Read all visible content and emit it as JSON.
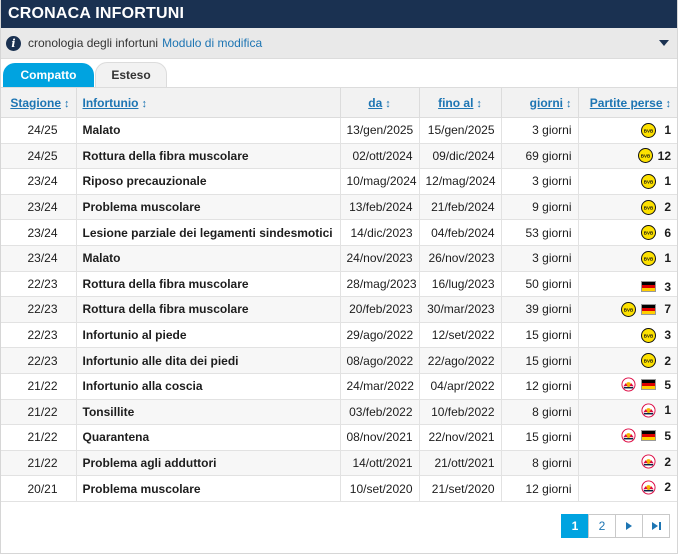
{
  "title": "CRONACA INFORTUNI",
  "info": {
    "text": "cronologia degli infortuni",
    "link": "Modulo di modifica"
  },
  "tabs": [
    {
      "label": "Compatto",
      "active": true
    },
    {
      "label": "Esteso",
      "active": false
    }
  ],
  "columns": {
    "season": "Stagione",
    "injury": "Infortunio",
    "from": "da",
    "to": "fino al",
    "days": "giorni",
    "games": "Partite perse",
    "sort_symbol": "↕"
  },
  "rows": [
    {
      "season": "24/25",
      "injury": "Malato",
      "from": "13/gen/2025",
      "to": "15/gen/2025",
      "days": "3 giorni",
      "badges": [
        "bvb-icon"
      ],
      "games": "1"
    },
    {
      "season": "24/25",
      "injury": "Rottura della fibra muscolare",
      "from": "02/ott/2024",
      "to": "09/dic/2024",
      "days": "69 giorni",
      "badges": [
        "bvb-icon"
      ],
      "games": "12"
    },
    {
      "season": "23/24",
      "injury": "Riposo precauzionale",
      "from": "10/mag/2024",
      "to": "12/mag/2024",
      "days": "3 giorni",
      "badges": [
        "bvb-icon"
      ],
      "games": "1"
    },
    {
      "season": "23/24",
      "injury": "Problema muscolare",
      "from": "13/feb/2024",
      "to": "21/feb/2024",
      "days": "9 giorni",
      "badges": [
        "bvb-icon"
      ],
      "games": "2"
    },
    {
      "season": "23/24",
      "injury": "Lesione parziale dei legamenti sindesmotici",
      "from": "14/dic/2023",
      "to": "04/feb/2024",
      "days": "53 giorni",
      "badges": [
        "bvb-icon"
      ],
      "games": "6"
    },
    {
      "season": "23/24",
      "injury": "Malato",
      "from": "24/nov/2023",
      "to": "26/nov/2023",
      "days": "3 giorni",
      "badges": [
        "bvb-icon"
      ],
      "games": "1"
    },
    {
      "season": "22/23",
      "injury": "Rottura della fibra muscolare",
      "from": "28/mag/2023",
      "to": "16/lug/2023",
      "days": "50 giorni",
      "badges": [
        "germany-flag-icon"
      ],
      "games": "3"
    },
    {
      "season": "22/23",
      "injury": "Rottura della fibra muscolare",
      "from": "20/feb/2023",
      "to": "30/mar/2023",
      "days": "39 giorni",
      "badges": [
        "bvb-icon",
        "germany-flag-icon"
      ],
      "games": "7"
    },
    {
      "season": "22/23",
      "injury": "Infortunio al piede",
      "from": "29/ago/2022",
      "to": "12/set/2022",
      "days": "15 giorni",
      "badges": [
        "bvb-icon"
      ],
      "games": "3"
    },
    {
      "season": "22/23",
      "injury": "Infortunio alle dita dei piedi",
      "from": "08/ago/2022",
      "to": "22/ago/2022",
      "days": "15 giorni",
      "badges": [
        "bvb-icon"
      ],
      "games": "2"
    },
    {
      "season": "21/22",
      "injury": "Infortunio alla coscia",
      "from": "24/mar/2022",
      "to": "04/apr/2022",
      "days": "12 giorni",
      "badges": [
        "rbl-icon",
        "germany-flag-icon"
      ],
      "games": "5"
    },
    {
      "season": "21/22",
      "injury": "Tonsillite",
      "from": "03/feb/2022",
      "to": "10/feb/2022",
      "days": "8 giorni",
      "badges": [
        "rbl-icon"
      ],
      "games": "1"
    },
    {
      "season": "21/22",
      "injury": "Quarantena",
      "from": "08/nov/2021",
      "to": "22/nov/2021",
      "days": "15 giorni",
      "badges": [
        "rbl-icon",
        "germany-flag-icon"
      ],
      "games": "5"
    },
    {
      "season": "21/22",
      "injury": "Problema agli adduttori",
      "from": "14/ott/2021",
      "to": "21/ott/2021",
      "days": "8 giorni",
      "badges": [
        "rbl-icon"
      ],
      "games": "2"
    },
    {
      "season": "20/21",
      "injury": "Problema muscolare",
      "from": "10/set/2020",
      "to": "21/set/2020",
      "days": "12 giorni",
      "badges": [
        "rbl-icon"
      ],
      "games": "2"
    }
  ],
  "pagination": {
    "pages": [
      "1",
      "2"
    ],
    "current": "1",
    "next_icon": "next-page-icon",
    "last_icon": "last-page-icon"
  },
  "colors": {
    "header_navy": "#1a3151",
    "accent_blue": "#00a3e0",
    "link_blue": "#1d75b3",
    "bvb_yellow": "#fde100",
    "rbl_red": "#dd0741"
  }
}
